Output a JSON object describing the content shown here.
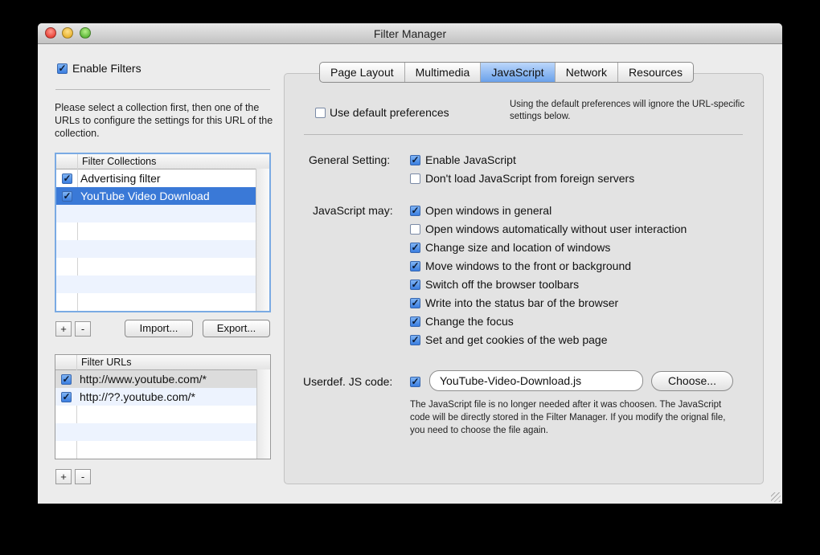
{
  "window": {
    "title": "Filter Manager"
  },
  "left": {
    "enable_filters": {
      "label": "Enable Filters",
      "checked": true
    },
    "instruction": "Please select a collection first, then one of the URLs to configure the settings for this URL of the collection.",
    "collections": {
      "header": "Filter Collections",
      "items": [
        {
          "label": "Advertising filter",
          "checked": true,
          "selected": false
        },
        {
          "label": "YouTube Video Download",
          "checked": true,
          "selected": true
        }
      ]
    },
    "add_label": "+",
    "remove_label": "-",
    "import_label": "Import...",
    "export_label": "Export...",
    "urls": {
      "header": "Filter URLs",
      "items": [
        {
          "label": "http://www.youtube.com/*",
          "checked": true
        },
        {
          "label": "http://??.youtube.com/*",
          "checked": true
        }
      ]
    }
  },
  "tabs": [
    {
      "label": "Page Layout",
      "active": false
    },
    {
      "label": "Multimedia",
      "active": false
    },
    {
      "label": "JavaScript",
      "active": true
    },
    {
      "label": "Network",
      "active": false
    },
    {
      "label": "Resources",
      "active": false
    }
  ],
  "main": {
    "use_default": {
      "label": "Use default preferences",
      "checked": false
    },
    "default_note": "Using the default preferences will ignore the URL-specific settings below.",
    "general_label": "General Setting:",
    "general": [
      {
        "label": "Enable JavaScript",
        "checked": true
      },
      {
        "label": "Don't load JavaScript from foreign servers",
        "checked": false
      }
    ],
    "may_label": "JavaScript may:",
    "may": [
      {
        "label": "Open windows in general",
        "checked": true
      },
      {
        "label": "Open windows automatically without user interaction",
        "checked": false
      },
      {
        "label": "Change size and location of windows",
        "checked": true
      },
      {
        "label": "Move windows to the front or background",
        "checked": true
      },
      {
        "label": "Switch off the browser toolbars",
        "checked": true
      },
      {
        "label": "Write into the status bar of the browser",
        "checked": true
      },
      {
        "label": "Change the focus",
        "checked": true
      },
      {
        "label": "Set and get cookies of the web page",
        "checked": true
      }
    ],
    "userdef_label": "Userdef. JS code:",
    "userdef_checked": true,
    "js_file": "YouTube-Video-Download.js",
    "choose_label": "Choose...",
    "note": "The JavaScript file is no longer needed after it was choosen. The JavaScript code will be directly stored in the Filter Manager. If you modify the orignal file, you need to choose the file again."
  },
  "colors": {
    "selection": "#3a79d7",
    "tab_active": "#6aa1ea",
    "check": "#3a7ee0"
  }
}
